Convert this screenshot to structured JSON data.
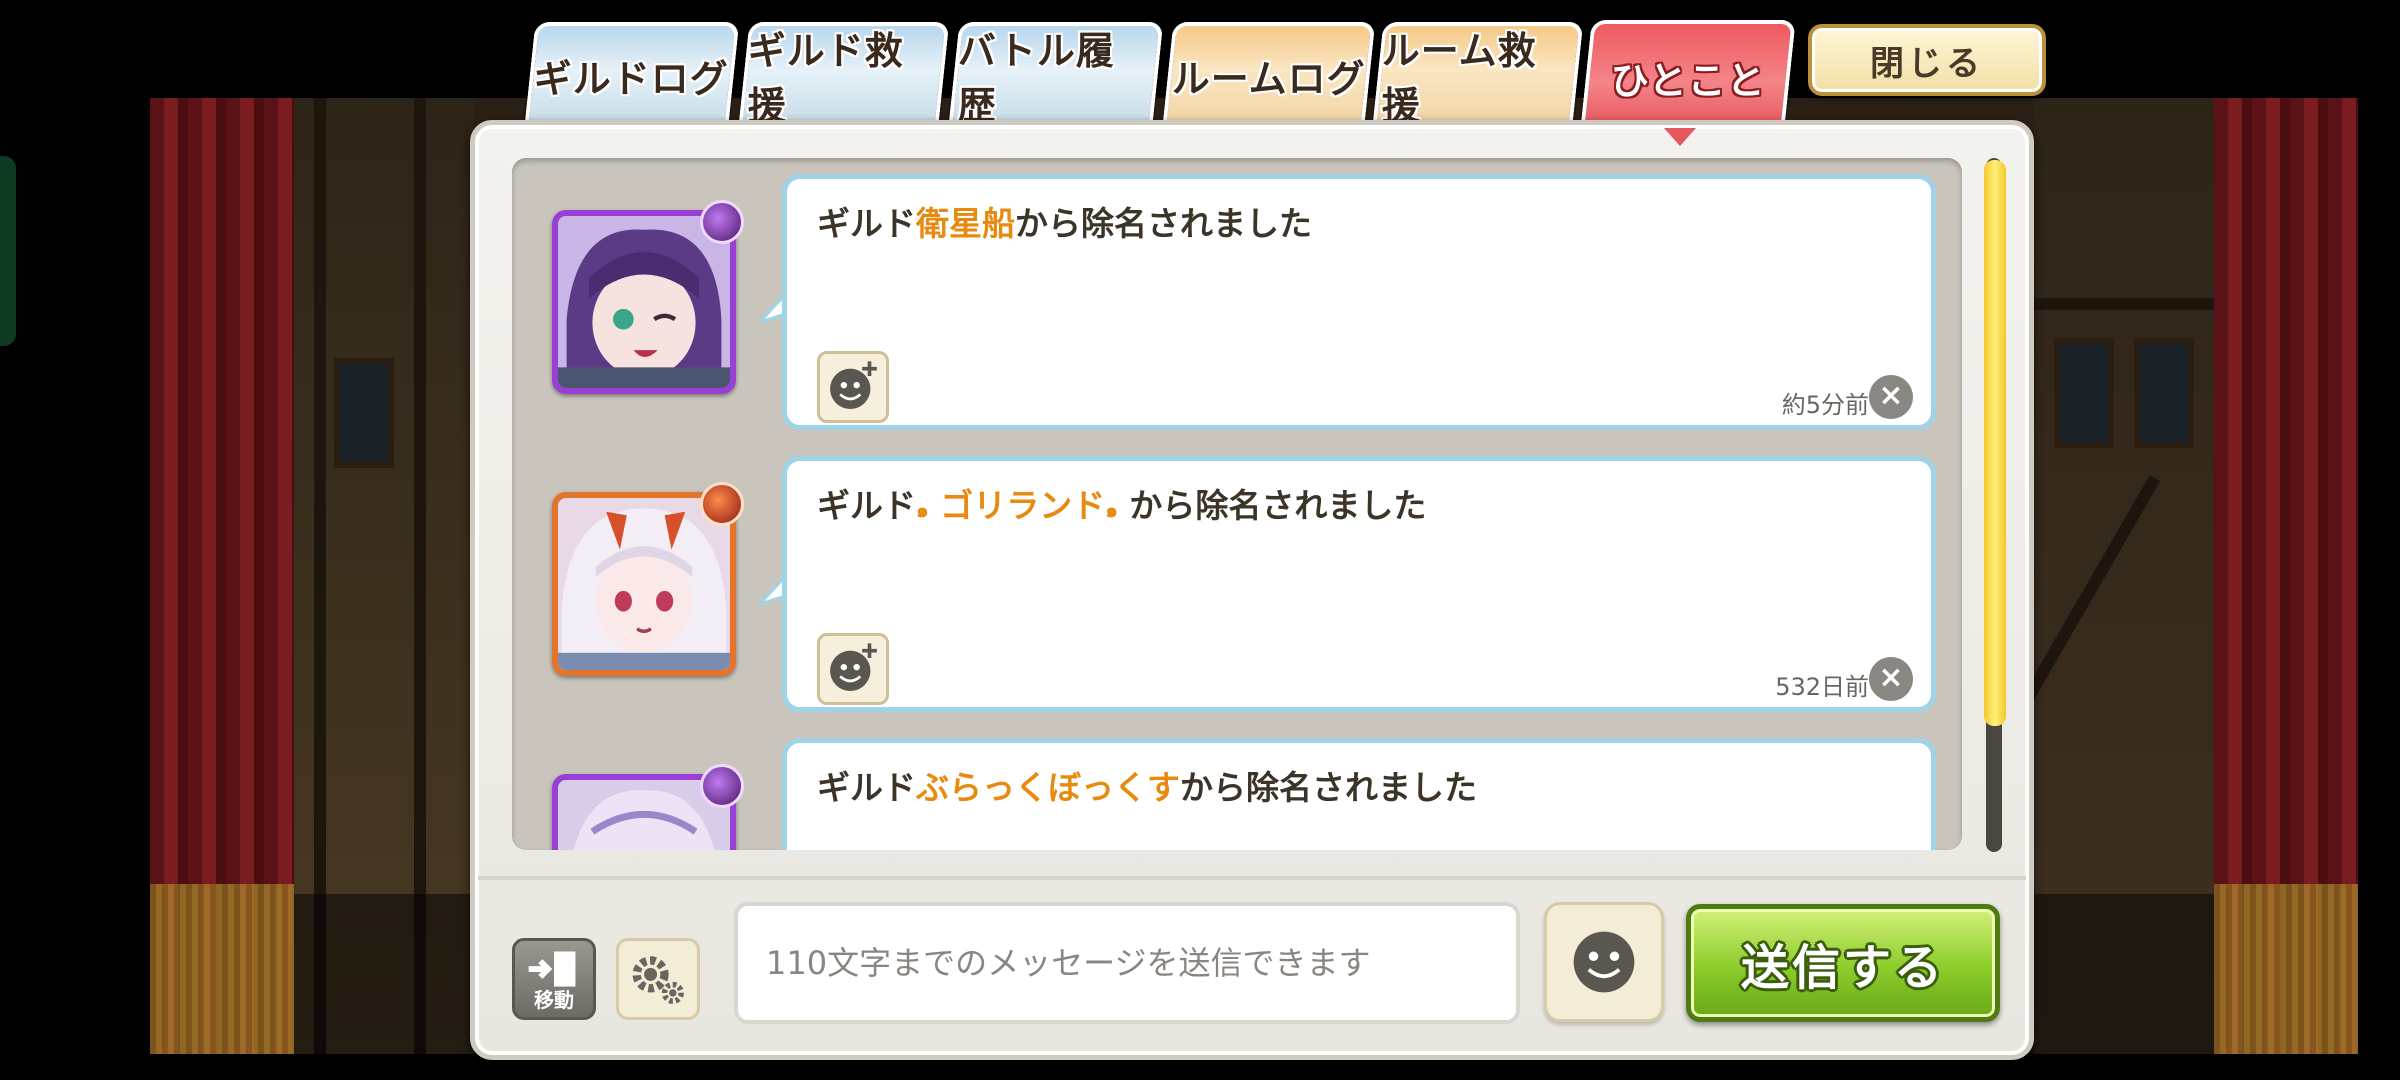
{
  "tabs": [
    {
      "label": "ギルドログ",
      "state": "inactive",
      "color": "#c7dde9"
    },
    {
      "label": "ギルド救援",
      "state": "inactive",
      "color": "#c7dde9"
    },
    {
      "label": "バトル履歴",
      "state": "inactive",
      "color": "#c7dde9"
    },
    {
      "label": "ルームログ",
      "state": "inactive",
      "color": "#f1d4a4"
    },
    {
      "label": "ルーム救援",
      "state": "inactive",
      "color": "#f1d4a4"
    },
    {
      "label": "ひとこと",
      "state": "active",
      "color": "#e6565c"
    }
  ],
  "close_button": {
    "label": "閉じる"
  },
  "messages": [
    {
      "prefix": "ギルド",
      "guild": "衛星船",
      "suffix": "から除名されました",
      "time": "約5分前",
      "avatar_icon": "character-avatar-icon",
      "element_icon": "dark-element-icon"
    },
    {
      "prefix": "ギルド",
      "guild": "ゴリランド",
      "suffix": "から除名されました",
      "time": "532日前",
      "avatar_icon": "character-avatar-icon",
      "element_icon": "fire-element-icon",
      "guild_deco": "๑"
    },
    {
      "prefix": "ギルド",
      "guild": "ぶらっくぼっくす",
      "suffix": "から除名されました",
      "time": "",
      "avatar_icon": "character-avatar-icon",
      "element_icon": "dark-element-icon"
    }
  ],
  "bottom_bar": {
    "move_label": "移動",
    "input_placeholder": "110文字までのメッセージを送信できます",
    "send_label": "送信する"
  },
  "colors": {
    "highlight": "#e88a10",
    "bubble_border": "#9fd3ea",
    "send_green": "#8bcc2a"
  }
}
